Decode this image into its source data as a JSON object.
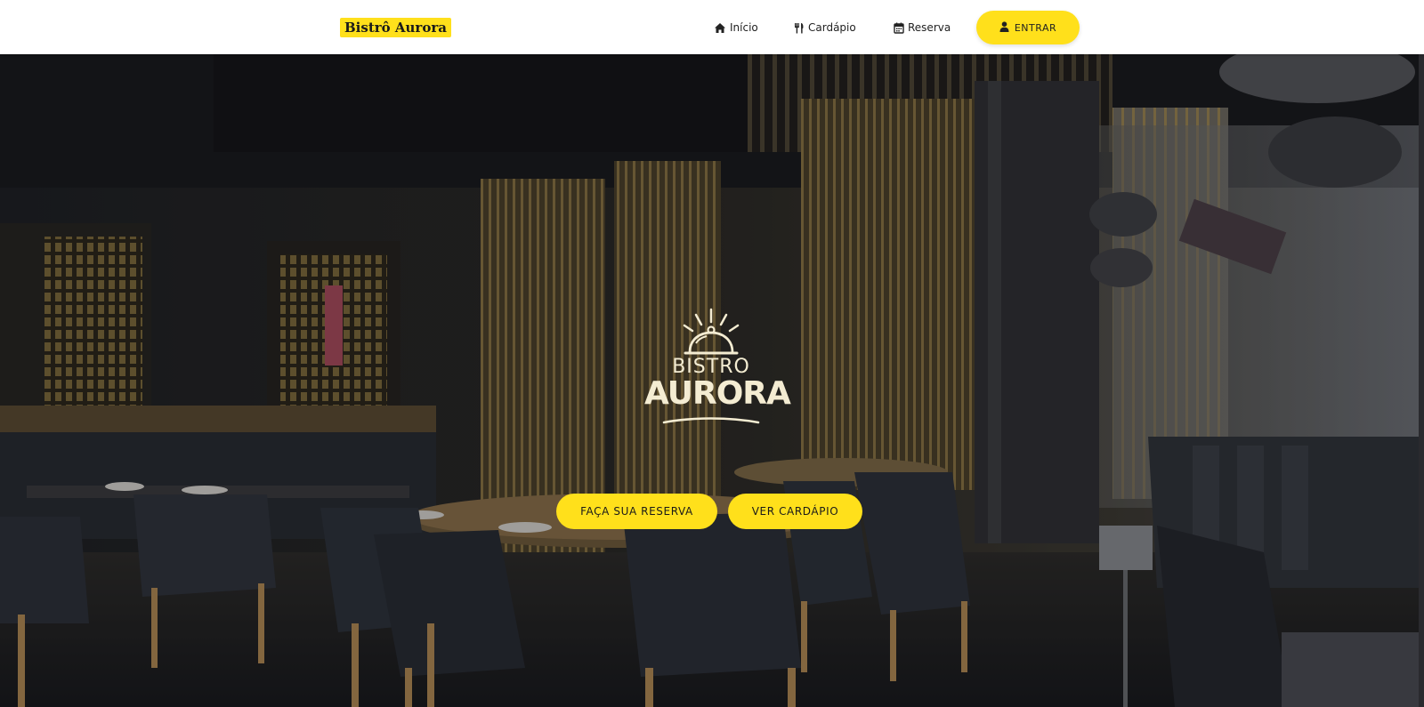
{
  "navbar": {
    "brand": "Bistrô Aurora",
    "links": [
      {
        "label": "Início",
        "icon": "home-icon"
      },
      {
        "label": "Cardápio",
        "icon": "utensils-icon"
      },
      {
        "label": "Reserva",
        "icon": "calendar-icon"
      }
    ],
    "login_label": "ENTRAR",
    "login_icon": "user-icon"
  },
  "hero": {
    "logo_line1": "BISTRO",
    "logo_line2": "AURORA",
    "logo_icon": "cloche-icon",
    "primary_button": "FAÇA SUA RESERVA",
    "secondary_button": "VER CARDÁPIO",
    "background": "restaurant-interior-photo"
  },
  "colors": {
    "accent": "#ffe01b",
    "navbar_bg": "#ffffff",
    "logo_text": "#f4ecd2"
  }
}
